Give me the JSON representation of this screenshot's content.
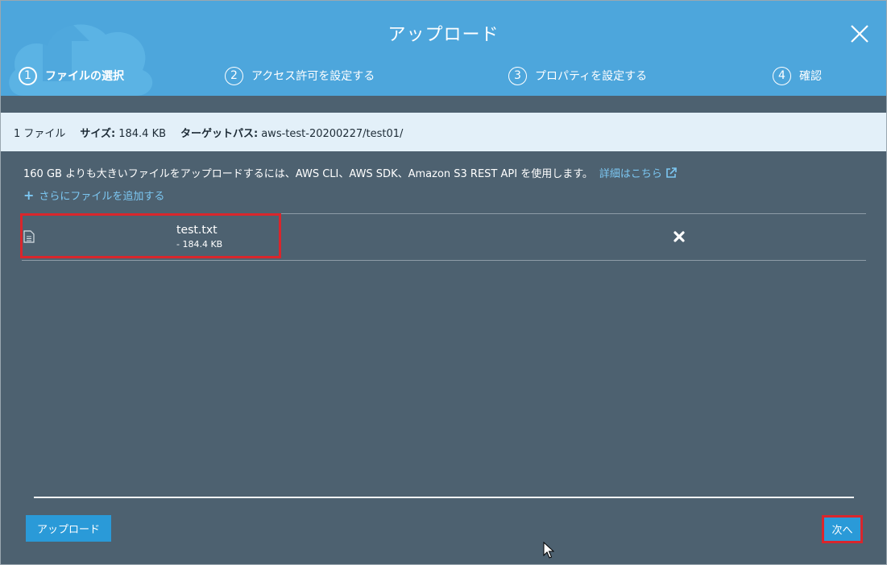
{
  "dialog": {
    "title": "アップロード",
    "close_icon": "close-icon"
  },
  "steps": [
    {
      "number": "1",
      "label": "ファイルの選択",
      "active": true
    },
    {
      "number": "2",
      "label": "アクセス許可を設定する",
      "active": false
    },
    {
      "number": "3",
      "label": "プロパティを設定する",
      "active": false
    },
    {
      "number": "4",
      "label": "確認",
      "active": false
    }
  ],
  "summary": {
    "file_count": "1 ファイル",
    "size_label": "サイズ:",
    "size_value": "184.4 KB",
    "target_label": "ターゲットパス:",
    "target_value": "aws-test-20200227/test01/"
  },
  "info": {
    "message": "160 GB よりも大きいファイルをアップロードするには、AWS CLI、AWS SDK、Amazon S3 REST API を使用します。",
    "link_text": "詳細はこちら",
    "link_icon": "external-link-icon"
  },
  "add_more": {
    "label": "さらにファイルを追加する",
    "icon": "plus-icon"
  },
  "files": [
    {
      "name": "test.txt",
      "size": "- 184.4 KB",
      "icon": "file-icon",
      "remove_icon": "remove-icon"
    }
  ],
  "footer": {
    "upload_label": "アップロード",
    "next_label": "次へ"
  },
  "colors": {
    "header": "#4da6dc",
    "body": "#4d6170",
    "summary_bg": "#e3f0f9",
    "accent": "#2a9ad8",
    "highlight": "#d9262c"
  }
}
